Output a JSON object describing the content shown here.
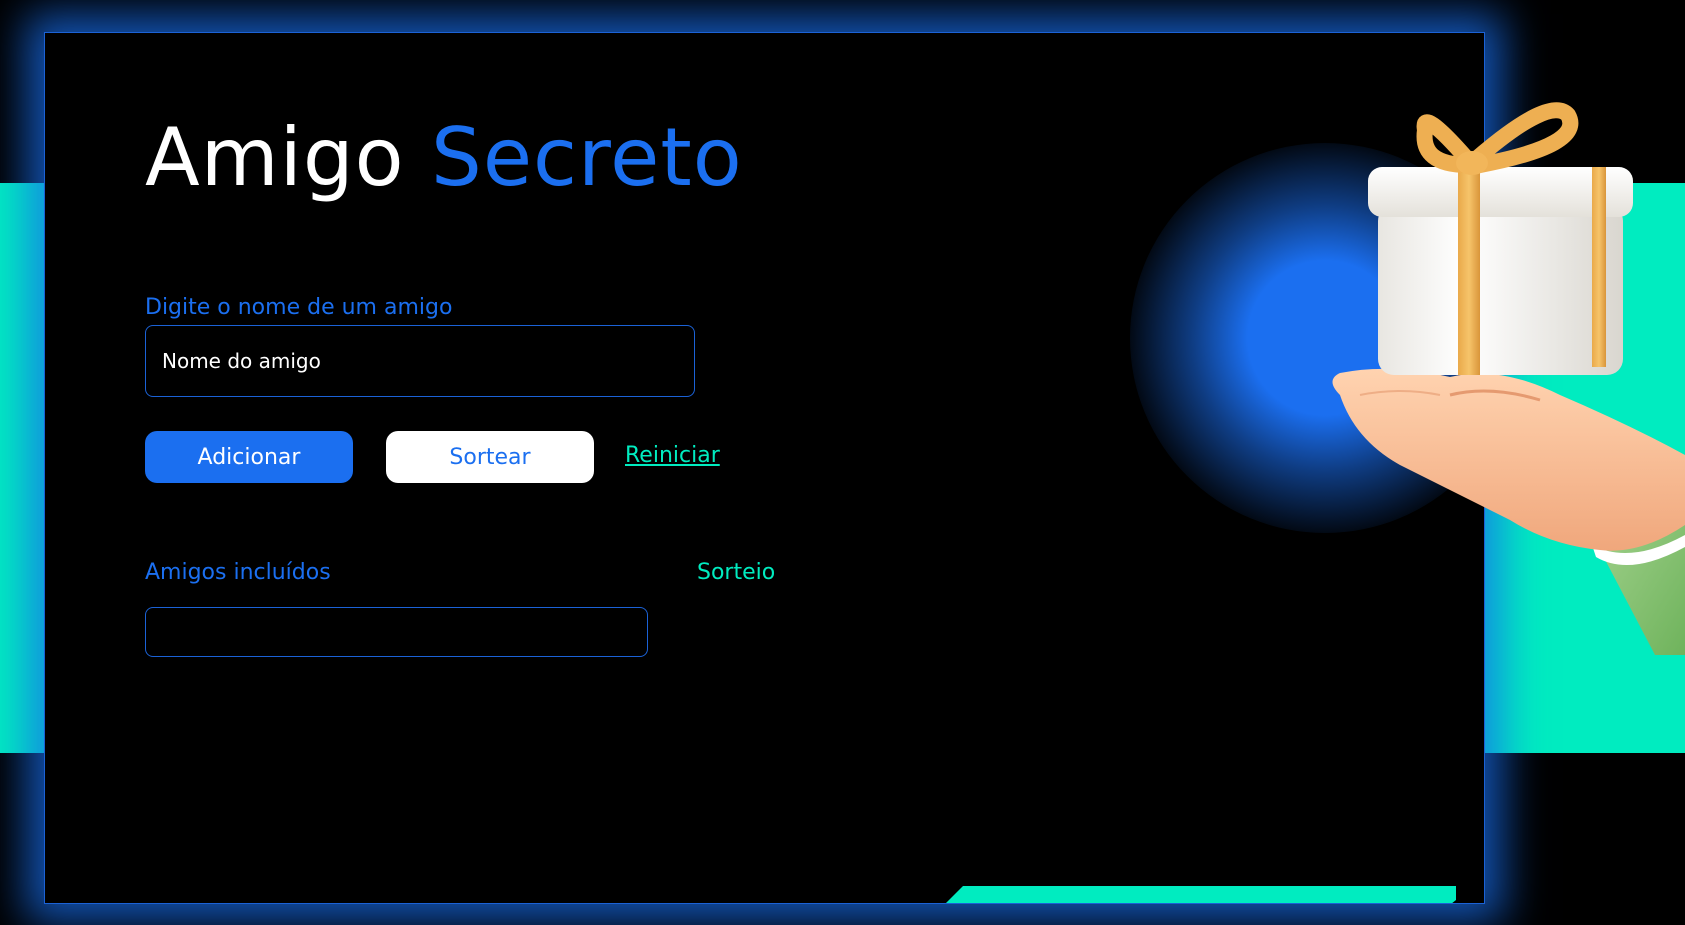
{
  "header": {
    "title_part1": "Amigo",
    "title_part2": "Secreto"
  },
  "form": {
    "input_label": "Digite o nome de um amigo",
    "input_placeholder": "Nome do amigo",
    "add_button": "Adicionar",
    "draw_button": "Sortear",
    "reset_link": "Reiniciar"
  },
  "lists": {
    "friends_label": "Amigos incluídos",
    "friends": [],
    "result_label": "Sorteio"
  },
  "illustration": {
    "icon": "gift-hand-illustration"
  },
  "colors": {
    "background": "#000000",
    "accent_blue": "#1b6ff0",
    "accent_teal": "#00ecc0",
    "text_white": "#ffffff"
  }
}
